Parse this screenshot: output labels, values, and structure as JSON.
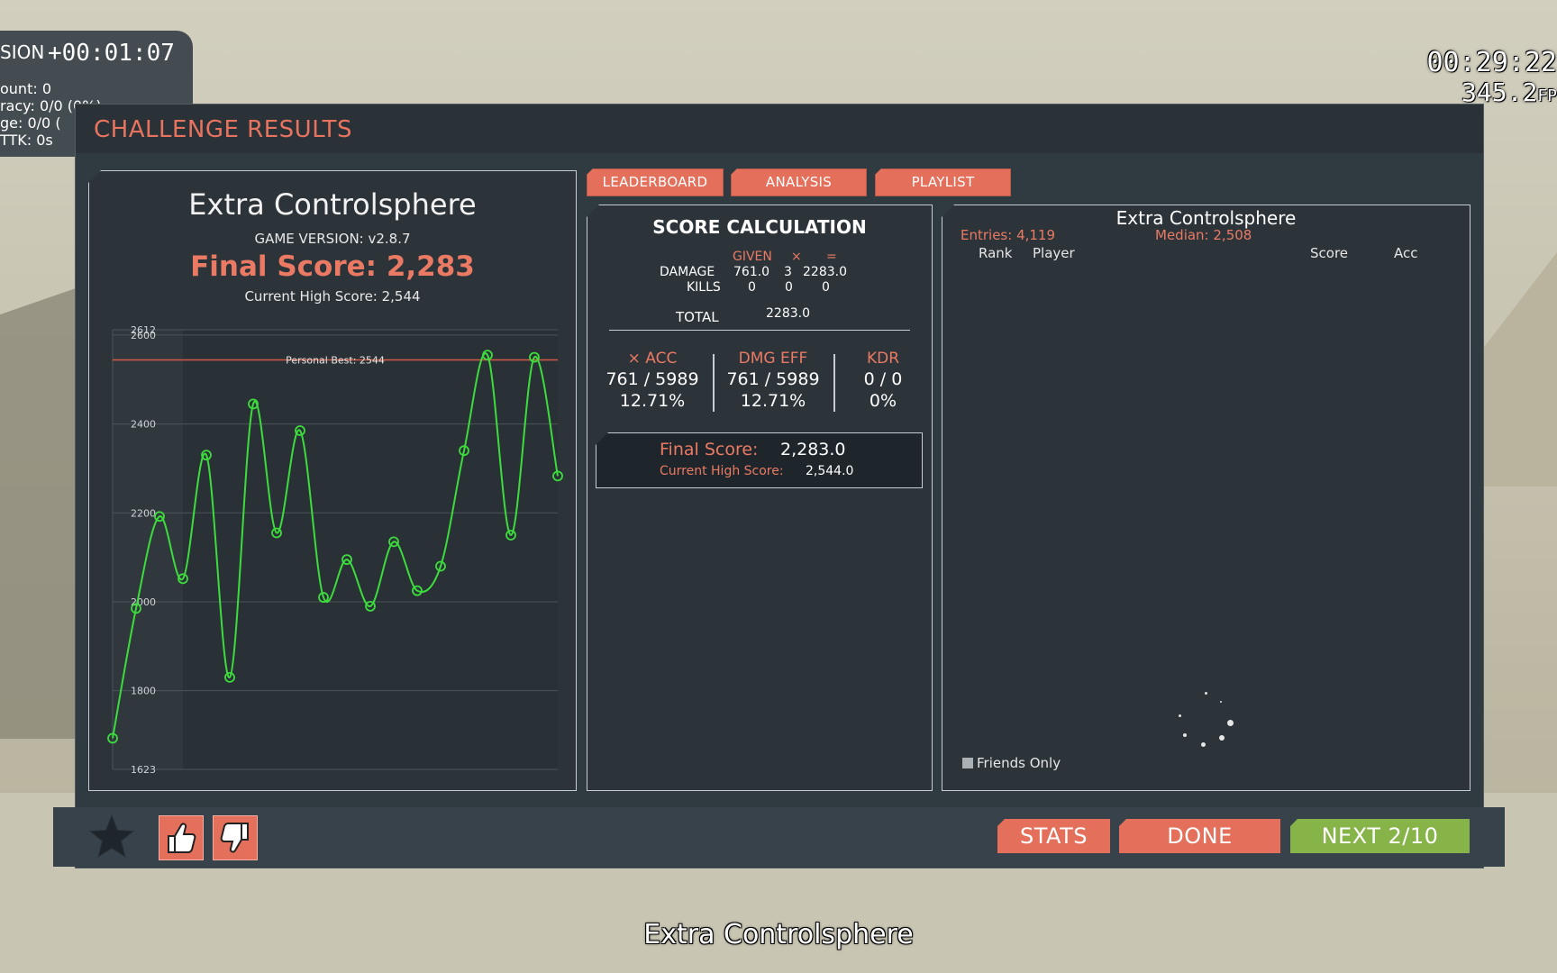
{
  "hud": {
    "session_label": "SION",
    "session_timer": "+00:01:07",
    "stats": [
      "ount: 0",
      "racy: 0/0 (0%)",
      "ge: 0/0 (",
      "TTK: 0s"
    ],
    "clock": "00:29:22",
    "fps": "345.2",
    "fps_unit": "FP"
  },
  "window": {
    "title": "CHALLENGE RESULTS"
  },
  "summary": {
    "scenario_name": "Extra Controlsphere",
    "game_version": "GAME VERSION: v2.8.7",
    "final_score": "Final Score: 2,283",
    "current_high": "Current High Score: 2,544"
  },
  "chart_data": {
    "type": "line",
    "x": [
      1,
      2,
      3,
      4,
      5,
      6,
      7,
      8,
      9,
      10,
      11,
      12,
      13,
      14,
      15,
      16,
      17,
      18,
      19,
      20
    ],
    "values": [
      1693,
      1985,
      2192,
      2052,
      2330,
      1830,
      2445,
      2155,
      2385,
      2010,
      2095,
      1990,
      2135,
      2025,
      2080,
      2340,
      2555,
      2150,
      2550,
      2283
    ],
    "ylim": [
      1623,
      2612
    ],
    "yticks": [
      "1623",
      "1800",
      "2000",
      "2200",
      "2400",
      "2600",
      "2612"
    ],
    "personal_best_value": 2544,
    "personal_best_label": "Personal Best: 2544",
    "line_color": "#3ddc3d",
    "pb_color": "#d35a46",
    "grid": true
  },
  "tabs": [
    {
      "label": "LEADERBOARD"
    },
    {
      "label": "ANALYSIS"
    },
    {
      "label": "PLAYLIST"
    }
  ],
  "score_calc": {
    "title": "SCORE CALCULATION",
    "header_given": "GIVEN",
    "header_times": "×",
    "header_equals": "=",
    "damage_label": "DAMAGE",
    "damage_given": "761.0",
    "damage_mult": "3",
    "damage_result": "2283.0",
    "kills_label": "KILLS",
    "kills_given": "0",
    "kills_mult": "0",
    "kills_result": "0",
    "total_label": "TOTAL",
    "total_value": "2283.0",
    "acc_label": "× ACC",
    "acc_ratio": "761 / 5989",
    "acc_pct": "12.71%",
    "dmgeff_label": "DMG EFF",
    "dmgeff_ratio": "761 / 5989",
    "dmgeff_pct": "12.71%",
    "kdr_label": "KDR",
    "kdr_ratio": "0 / 0",
    "kdr_pct": "0%",
    "final_label": "Final Score:",
    "final_value": "2,283.0",
    "high_label": "Current High Score:",
    "high_value": "2,544.0"
  },
  "leaderboard": {
    "title": "Extra Controlsphere",
    "entries": "Entries: 4,119",
    "median": "Median: 2,508",
    "col_rank": "Rank",
    "col_player": "Player",
    "col_score": "Score",
    "col_acc": "Acc",
    "friends_only": "Friends Only"
  },
  "buttons": {
    "stats": "STATS",
    "done": "DONE",
    "next": "NEXT 2/10"
  },
  "subtitle": "Extra Controlsphere"
}
